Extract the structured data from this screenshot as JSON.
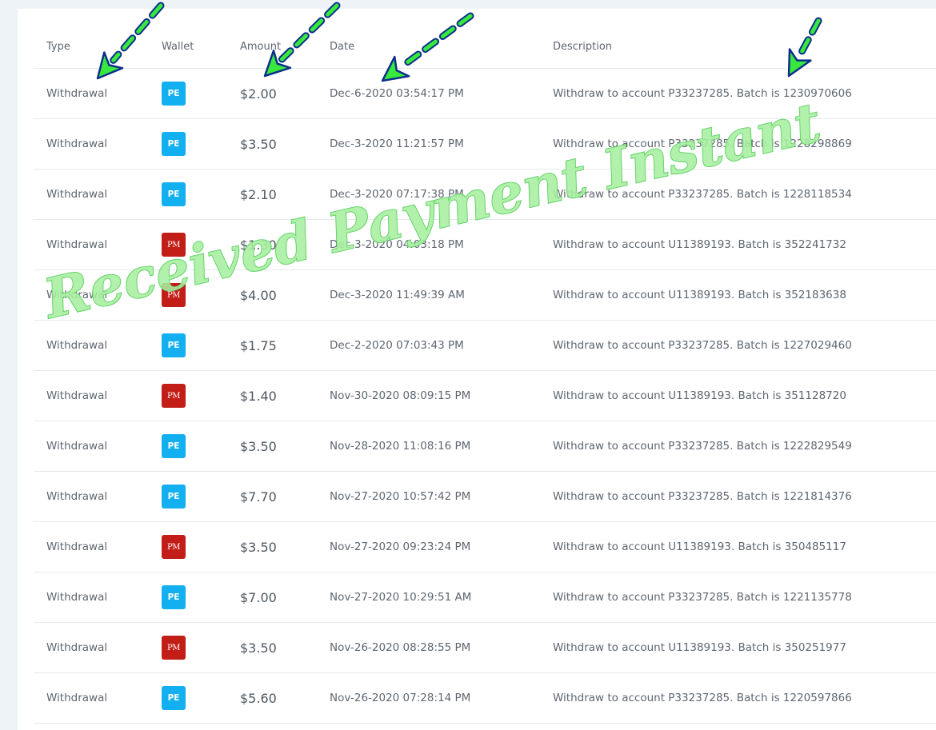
{
  "headers": {
    "type": "Type",
    "wallet": "Wallet",
    "amount": "Amount",
    "date": "Date",
    "description": "Description"
  },
  "rows": [
    {
      "type": "Withdrawal",
      "wallet": "PE",
      "amount": "$2.00",
      "date": "Dec-6-2020 03:54:17 PM",
      "description": "Withdraw to account P33237285. Batch is 1230970606"
    },
    {
      "type": "Withdrawal",
      "wallet": "PE",
      "amount": "$3.50",
      "date": "Dec-3-2020 11:21:57 PM",
      "description": "Withdraw to account P33237285. Batch is 1228298869"
    },
    {
      "type": "Withdrawal",
      "wallet": "PE",
      "amount": "$2.10",
      "date": "Dec-3-2020 07:17:38 PM",
      "description": "Withdraw to account P33237285. Batch is 1228118534"
    },
    {
      "type": "Withdrawal",
      "wallet": "PM",
      "amount": "$1.30",
      "date": "Dec-3-2020 04:03:18 PM",
      "description": "Withdraw to account U11389193. Batch is 352241732"
    },
    {
      "type": "Withdrawal",
      "wallet": "PM",
      "amount": "$4.00",
      "date": "Dec-3-2020 11:49:39 AM",
      "description": "Withdraw to account U11389193. Batch is 352183638"
    },
    {
      "type": "Withdrawal",
      "wallet": "PE",
      "amount": "$1.75",
      "date": "Dec-2-2020 07:03:43 PM",
      "description": "Withdraw to account P33237285. Batch is 1227029460"
    },
    {
      "type": "Withdrawal",
      "wallet": "PM",
      "amount": "$1.40",
      "date": "Nov-30-2020 08:09:15 PM",
      "description": "Withdraw to account U11389193. Batch is 351128720"
    },
    {
      "type": "Withdrawal",
      "wallet": "PE",
      "amount": "$3.50",
      "date": "Nov-28-2020 11:08:16 PM",
      "description": "Withdraw to account P33237285. Batch is 1222829549"
    },
    {
      "type": "Withdrawal",
      "wallet": "PE",
      "amount": "$7.70",
      "date": "Nov-27-2020 10:57:42 PM",
      "description": "Withdraw to account P33237285. Batch is 1221814376"
    },
    {
      "type": "Withdrawal",
      "wallet": "PM",
      "amount": "$3.50",
      "date": "Nov-27-2020 09:23:24 PM",
      "description": "Withdraw to account U11389193. Batch is 350485117"
    },
    {
      "type": "Withdrawal",
      "wallet": "PE",
      "amount": "$7.00",
      "date": "Nov-27-2020 10:29:51 AM",
      "description": "Withdraw to account P33237285. Batch is 1221135778"
    },
    {
      "type": "Withdrawal",
      "wallet": "PM",
      "amount": "$3.50",
      "date": "Nov-26-2020 08:28:55 PM",
      "description": "Withdraw to account U11389193. Batch is 350251977"
    },
    {
      "type": "Withdrawal",
      "wallet": "PE",
      "amount": "$5.60",
      "date": "Nov-26-2020 07:28:14 PM",
      "description": "Withdraw to account P33237285. Batch is 1220597866"
    }
  ],
  "watermark": {
    "text": "Received Payment Instant",
    "fill": "#a6ef9f",
    "stroke": "#54c95a"
  },
  "annotation": {
    "arrow_fill": "#39e83c",
    "arrow_stroke": "#0d2f8c"
  },
  "colors": {
    "pe_badge": "#12b0f0",
    "pm_badge": "#c31d17"
  }
}
